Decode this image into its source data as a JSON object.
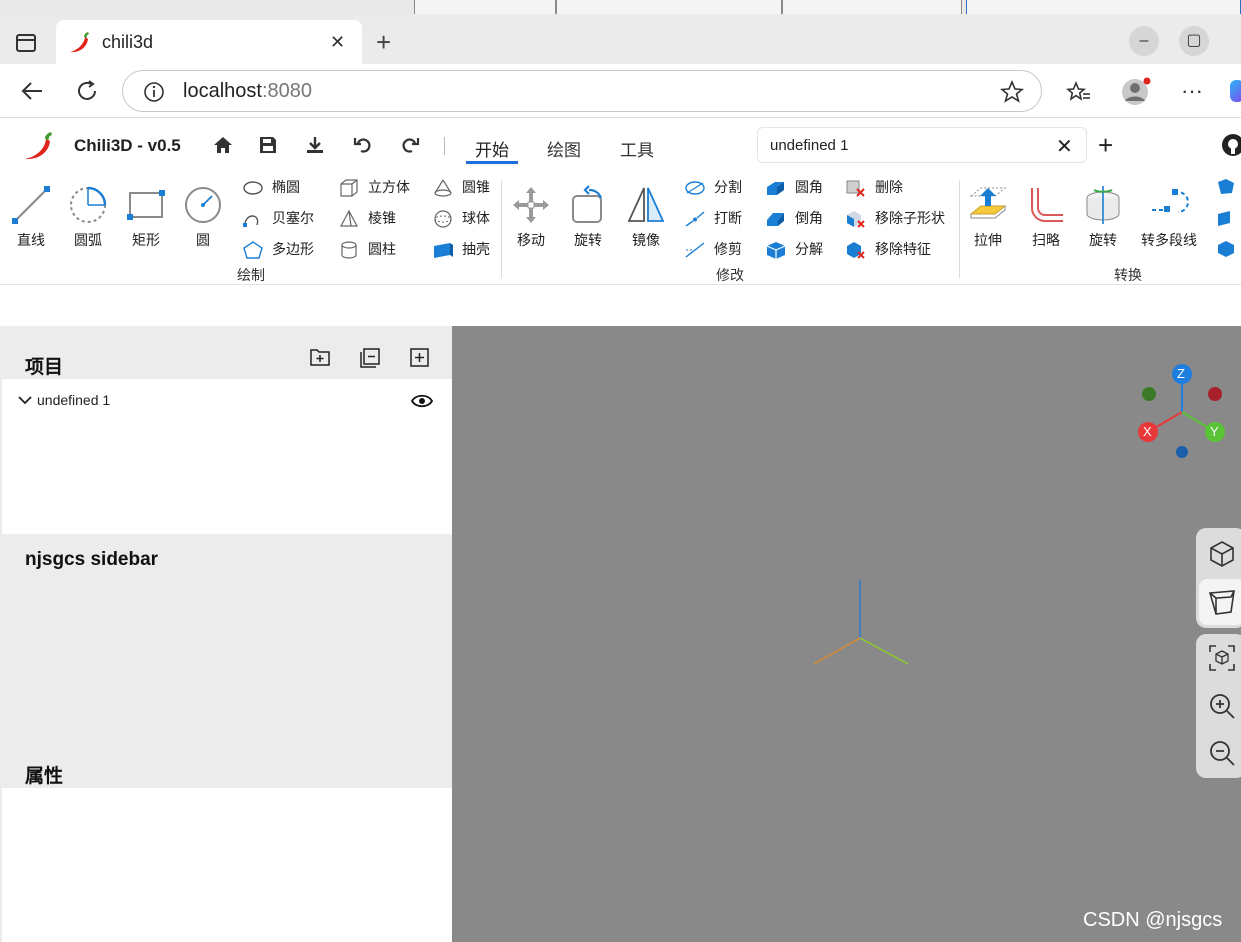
{
  "browser": {
    "tab_title": "chili3d",
    "tab_close": "✕",
    "new_tab": "+",
    "url_host": "localhost",
    "url_port": ":8080",
    "window_controls": {
      "minimize": "–",
      "maximize": "▢"
    }
  },
  "app": {
    "name": "Chili3D - v0.5",
    "ribbon_tabs": [
      "开始",
      "绘图",
      "工具"
    ],
    "active_tab": "开始",
    "document_tab": "undefined 1",
    "accent": "#1e6fd9"
  },
  "ribbon": {
    "draw": {
      "label": "绘制",
      "big": [
        "直线",
        "圆弧",
        "矩形",
        "圆"
      ],
      "col1": [
        "椭圆",
        "贝塞尔",
        "多边形"
      ],
      "col2": [
        "立方体",
        "棱锥",
        "圆柱"
      ],
      "col3": [
        "圆锥",
        "球体",
        "抽壳"
      ]
    },
    "modify": {
      "label": "修改",
      "big": [
        "移动",
        "旋转",
        "镜像"
      ],
      "col1": [
        "分割",
        "打断",
        "修剪"
      ],
      "col2": [
        "圆角",
        "倒角",
        "分解"
      ],
      "col3": [
        "删除",
        "移除子形状",
        "移除特征"
      ]
    },
    "convert": {
      "label": "转换",
      "big": [
        "拉伸",
        "扫略",
        "旋转",
        "转多段线"
      ]
    }
  },
  "sidebar": {
    "project_title": "项目",
    "tree_item": "undefined 1",
    "custom_title": "njsgcs sidebar",
    "properties_title": "属性"
  },
  "viewport": {
    "background": "#898989",
    "axes": {
      "z": "Z",
      "x": "X",
      "y": "Y"
    },
    "axis_colors": {
      "z": "#1f7fe0",
      "x": "#e8383a",
      "y": "#59c436"
    }
  },
  "watermark": "CSDN @njsgcs"
}
